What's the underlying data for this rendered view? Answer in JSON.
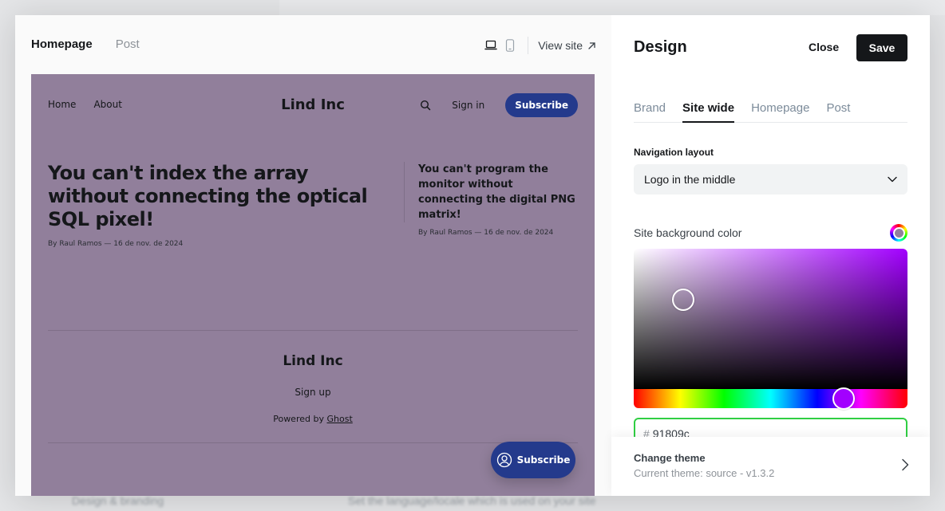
{
  "background": {
    "left_text": "Design & branding",
    "right_text": "Set the language/locale which is used on your site"
  },
  "preview": {
    "tabs": [
      {
        "label": "Homepage",
        "active": true
      },
      {
        "label": "Post",
        "active": false
      }
    ],
    "desktop_icon": "laptop-icon",
    "mobile_icon": "mobile-icon",
    "view_site_label": "View site",
    "site": {
      "background_color": "#917f9b",
      "accent_color": "#243a8c",
      "nav": [
        "Home",
        "About"
      ],
      "logo": "Lind Inc",
      "sign_in": "Sign in",
      "subscribe": "Subscribe",
      "main_post": {
        "title": "You can't index the array without connecting the optical SQL pixel!",
        "meta": "By Raul Ramos — 16 de nov. de 2024"
      },
      "side_post": {
        "title": "You can't program the monitor without connecting the digital PNG matrix!",
        "meta": "By Raul Ramos — 16 de nov. de 2024"
      },
      "footer": {
        "logo": "Lind Inc",
        "signup": "Sign up",
        "powered_prefix": "Powered by ",
        "powered_link": "Ghost"
      },
      "floating_subscribe": "Subscribe"
    }
  },
  "settings": {
    "title": "Design",
    "close_label": "Close",
    "save_label": "Save",
    "tabs": [
      {
        "label": "Brand",
        "active": false
      },
      {
        "label": "Site wide",
        "active": true
      },
      {
        "label": "Homepage",
        "active": false
      },
      {
        "label": "Post",
        "active": false
      }
    ],
    "navigation_layout": {
      "label": "Navigation layout",
      "value": "Logo in the middle"
    },
    "bg_color": {
      "label": "Site background color",
      "hex_prefix": "#",
      "hex_value": "91809c",
      "swatch_color": "#91809c",
      "hue_color": "#a200ff"
    },
    "theme": {
      "title": "Change theme",
      "subtitle": "Current theme: source - v1.3.2"
    }
  }
}
